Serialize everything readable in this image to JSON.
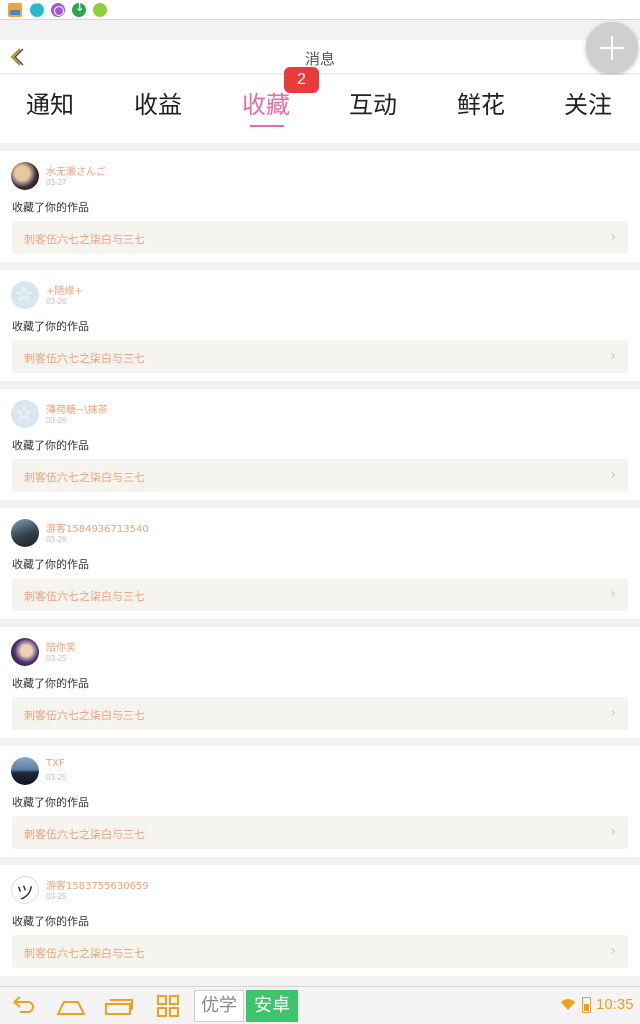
{
  "header": {
    "title": "消息"
  },
  "tabs": [
    {
      "label": "通知",
      "active": false
    },
    {
      "label": "收益",
      "active": false
    },
    {
      "label": "收藏",
      "active": true,
      "badge": "2"
    },
    {
      "label": "互动",
      "active": false
    },
    {
      "label": "鲜花",
      "active": false
    },
    {
      "label": "关注",
      "active": false
    }
  ],
  "notifications": [
    {
      "username": "水无瀬さんご",
      "date": "03-27",
      "action": "收藏了你的作品",
      "work": "刺客伍六七之柒白与三七",
      "avatar": "photo"
    },
    {
      "username": "+随缘+",
      "date": "03-26",
      "action": "收藏了你的作品",
      "work": "刺客伍六七之柒白与三七",
      "avatar": "default-star"
    },
    {
      "username": "薄荷糖~\\抹茶",
      "date": "03-26",
      "action": "收藏了你的作品",
      "work": "刺客伍六七之柒白与三七",
      "avatar": "default-star"
    },
    {
      "username": "游客1584936713540",
      "date": "03-26",
      "action": "收藏了你的作品",
      "work": "刺客伍六七之柒白与三七",
      "avatar": "photo"
    },
    {
      "username": "陪你笑",
      "date": "03-25",
      "action": "收藏了你的作品",
      "work": "刺客伍六七之柒白与三七",
      "avatar": "photo"
    },
    {
      "username": "TXF",
      "date": "03-25",
      "action": "收藏了你的作品",
      "work": "刺客伍六七之柒白与三七",
      "avatar": "photo"
    },
    {
      "username": "游客1583755630659",
      "date": "03-25",
      "action": "收藏了你的作品",
      "work": "刺客伍六七之柒白与三七",
      "avatar": "drawing"
    }
  ],
  "navbar": {
    "tag_a": "优学",
    "tag_b": "安卓",
    "time": "10:35"
  },
  "colors": {
    "accent": "#e86aa6",
    "badge": "#ea3b3b",
    "username": "#f2a07a",
    "status_orange": "#f0a020",
    "android_green": "#3ec46a"
  },
  "icons": [
    "gallery-icon",
    "chat-icon",
    "atom-icon",
    "download-icon",
    "app-icon",
    "back-chevron-icon",
    "plus-icon",
    "chevron-right-icon",
    "nav-back-icon",
    "nav-home-icon",
    "nav-recent-icon",
    "grid-icon",
    "wifi-icon",
    "battery-icon"
  ]
}
